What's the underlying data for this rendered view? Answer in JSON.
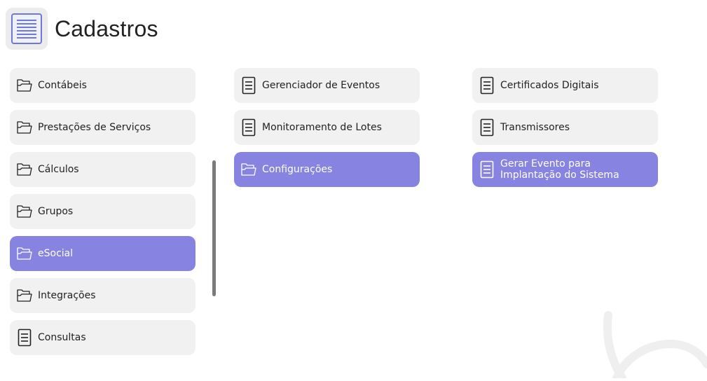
{
  "header": {
    "title": "Cadastros",
    "icon": "list-document-icon"
  },
  "colors": {
    "accent": "#8783e0",
    "item_bg": "#f1f1f1",
    "header_icon_bg": "#ececec"
  },
  "columns": [
    {
      "items": [
        {
          "label": "Contábeis",
          "icon": "folder-icon",
          "active": false
        },
        {
          "label": "Prestações de Serviços",
          "icon": "folder-icon",
          "active": false
        },
        {
          "label": "Cálculos",
          "icon": "folder-icon",
          "active": false
        },
        {
          "label": "Grupos",
          "icon": "folder-icon",
          "active": false
        },
        {
          "label": "eSocial",
          "icon": "folder-icon",
          "active": true
        },
        {
          "label": "Integrações",
          "icon": "folder-icon",
          "active": false
        },
        {
          "label": "Consultas",
          "icon": "document-icon",
          "active": false
        }
      ]
    },
    {
      "items": [
        {
          "label": "Gerenciador de Eventos",
          "icon": "document-icon",
          "active": false
        },
        {
          "label": "Monitoramento de Lotes",
          "icon": "document-icon",
          "active": false
        },
        {
          "label": "Configurações",
          "icon": "folder-icon",
          "active": true
        }
      ]
    },
    {
      "items": [
        {
          "label": "Certificados Digitais",
          "icon": "document-icon",
          "active": false
        },
        {
          "label": "Transmissores",
          "icon": "document-icon",
          "active": false
        },
        {
          "label": "Gerar Evento para Implantação do Sistema",
          "icon": "document-icon",
          "active": true
        }
      ]
    }
  ]
}
